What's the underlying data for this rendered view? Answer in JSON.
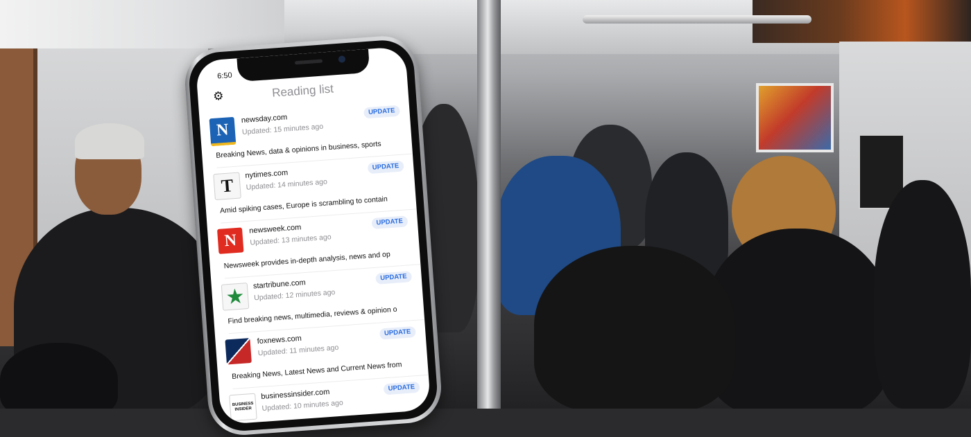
{
  "phone": {
    "status_time": "6:50",
    "header_title": "Reading list",
    "settings_icon": "gear-icon",
    "items": [
      {
        "domain": "newsday.com",
        "updated": "Updated: 15 minutes ago",
        "button": "UPDATE",
        "description": "Breaking News, data & opinions in business, sports",
        "logo_text": "N",
        "logo_icon": "newsday-logo"
      },
      {
        "domain": "nytimes.com",
        "updated": "Updated: 14 minutes ago",
        "button": "UPDATE",
        "description": "Amid spiking cases, Europe is scrambling to contain",
        "logo_text": "T",
        "logo_icon": "nytimes-logo"
      },
      {
        "domain": "newsweek.com",
        "updated": "Updated: 13 minutes ago",
        "button": "UPDATE",
        "description": "Newsweek provides in-depth analysis, news and op",
        "logo_text": "N",
        "logo_icon": "newsweek-logo"
      },
      {
        "domain": "startribune.com",
        "updated": "Updated: 12 minutes ago",
        "button": "UPDATE",
        "description": "Find breaking news, multimedia, reviews & opinion o",
        "logo_text": "★",
        "logo_icon": "startribune-logo"
      },
      {
        "domain": "foxnews.com",
        "updated": "Updated: 11 minutes ago",
        "button": "UPDATE",
        "description": "Breaking News, Latest News and Current News from",
        "logo_text": "",
        "logo_icon": "foxnews-logo"
      },
      {
        "domain": "businessinsider.com",
        "updated": "Updated: 10 minutes ago",
        "button": "UPDATE",
        "description": "",
        "logo_text": "BUSINESS INSIDER",
        "logo_icon": "businessinsider-logo"
      }
    ]
  },
  "colors": {
    "accent": "#2a6de0",
    "button_bg": "#e8eef9",
    "muted": "#8e8e93"
  }
}
